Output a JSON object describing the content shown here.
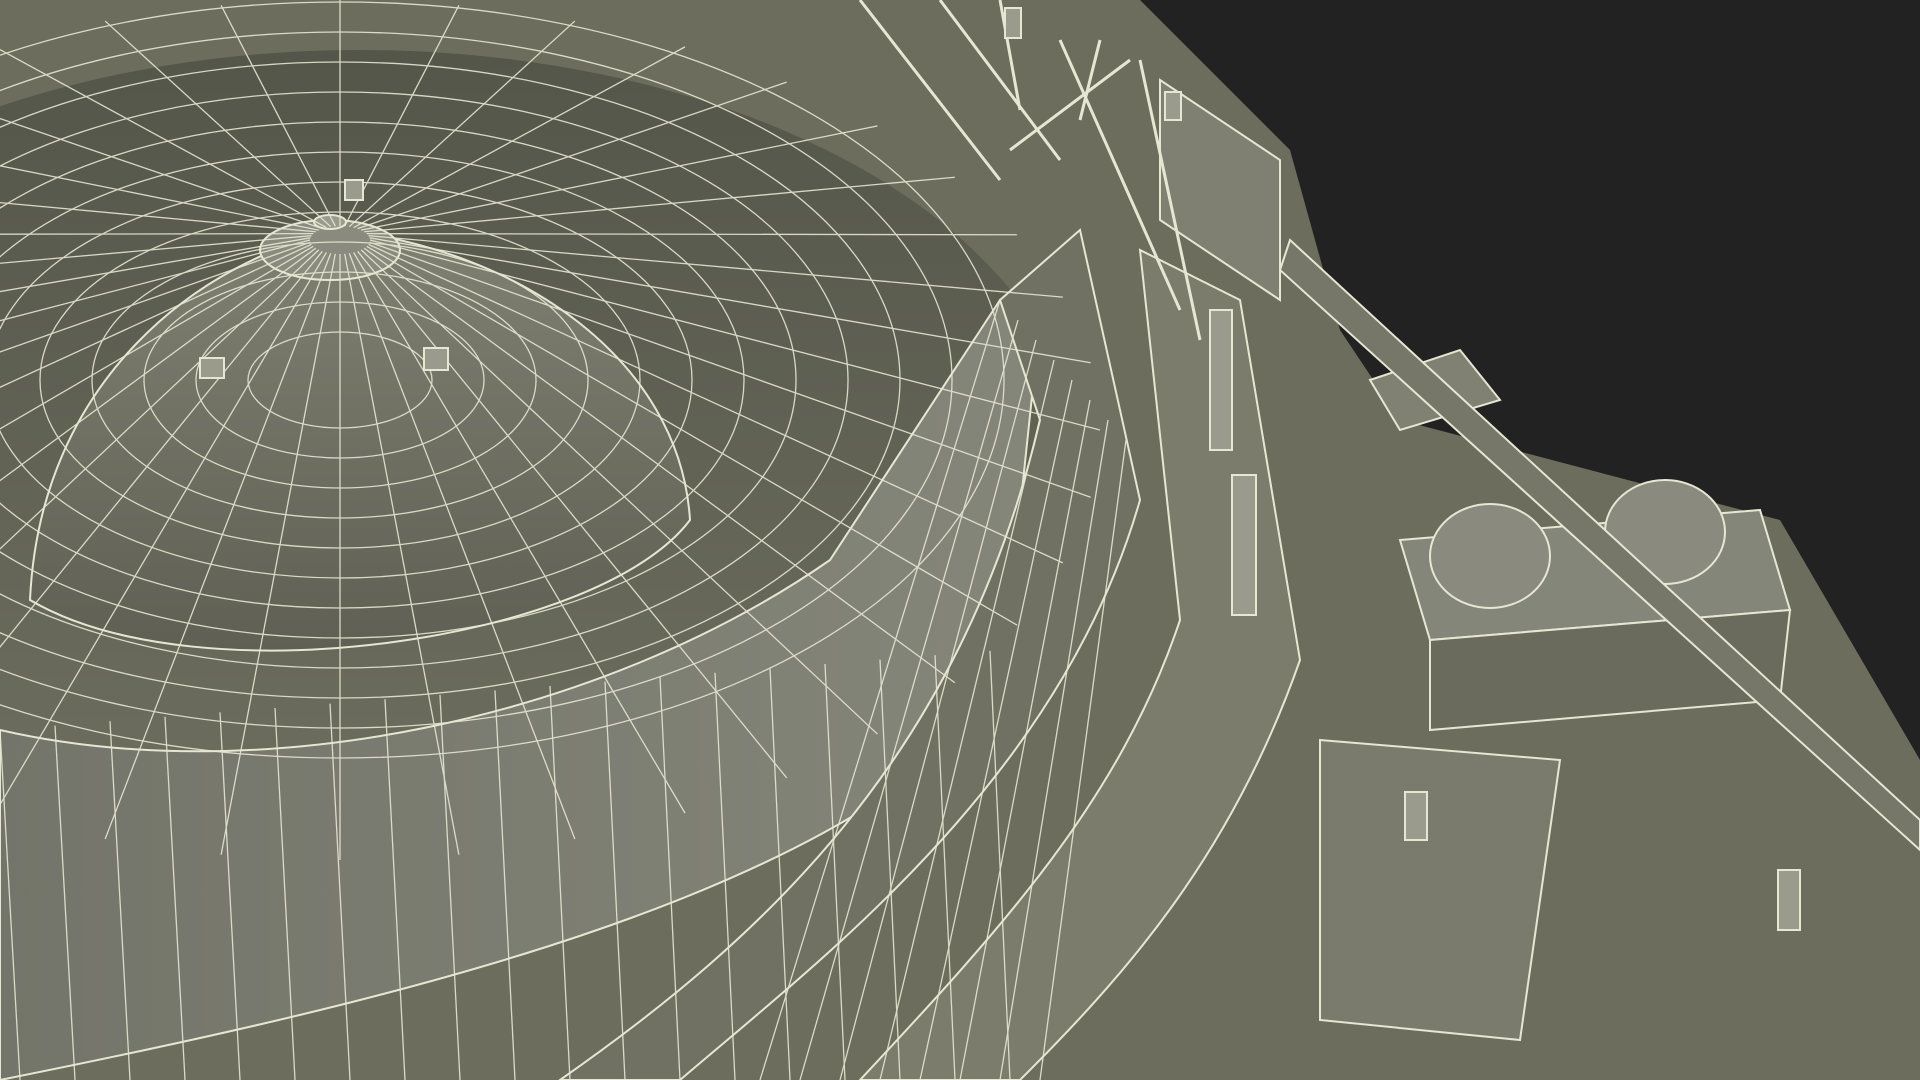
{
  "scene": {
    "subject": "wireframe-render",
    "colors": {
      "background": "#222222",
      "surface_light": "#7a7b69",
      "surface_mid": "#6b6c5c",
      "surface_dark": "#4e4f44",
      "wire": "#e6e6d2"
    }
  }
}
